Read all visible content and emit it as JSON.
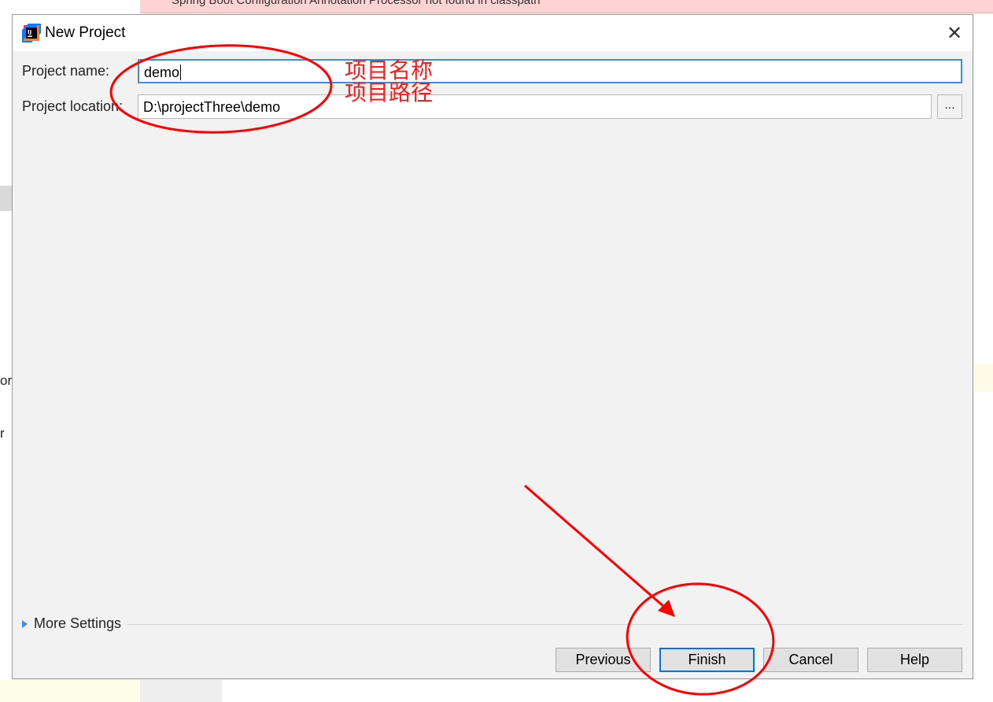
{
  "background": {
    "banner_text": "Spring Boot Configuration Annotation Processor not found in classpath",
    "left_fragment_1": "or",
    "left_fragment_2": "r"
  },
  "dialog": {
    "title": "New Project",
    "app_icon": "intellij-idea-icon",
    "close_label": "✕"
  },
  "form": {
    "name_label": "Project name:",
    "name_value": "demo",
    "location_label": "Project location:",
    "location_value": "D:\\projectThree\\demo",
    "browse_label": "..."
  },
  "more_settings": "More Settings",
  "buttons": {
    "previous": "Previous",
    "finish": "Finish",
    "cancel": "Cancel",
    "help": "Help"
  },
  "annotations": {
    "name_note": "项目名称",
    "location_note": "项目路径",
    "color": "#ff0000"
  },
  "colors": {
    "focus_border": "#3b8fd6",
    "default_button_border": "#0078d7",
    "banner_bg": "#ffd3d3"
  }
}
